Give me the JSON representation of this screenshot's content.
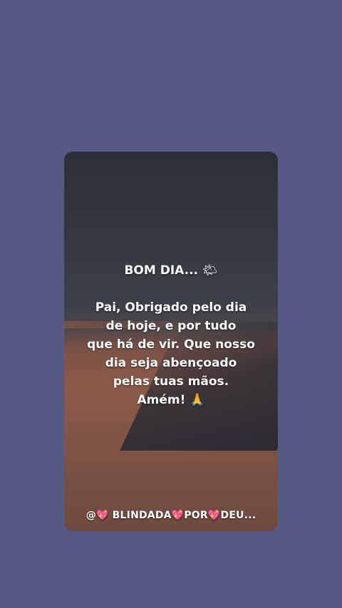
{
  "post": {
    "greeting": "BOM DIA...",
    "greeting_emoji": "🌤",
    "lines": [
      "Pai, Obrigado pelo dia",
      "de hoje, e por tudo",
      "que há de vir. Que nosso",
      "dia seja abençoado",
      "pelas tuas mãos."
    ],
    "closing": "Amém!",
    "closing_emoji": "🙏"
  },
  "footer": {
    "prefix": "@",
    "part1": "BLINDADA",
    "part2": "POR",
    "part3": "DEU...",
    "heart": "💖"
  },
  "colors": {
    "background": "#555a85",
    "text": "#ffffff"
  }
}
